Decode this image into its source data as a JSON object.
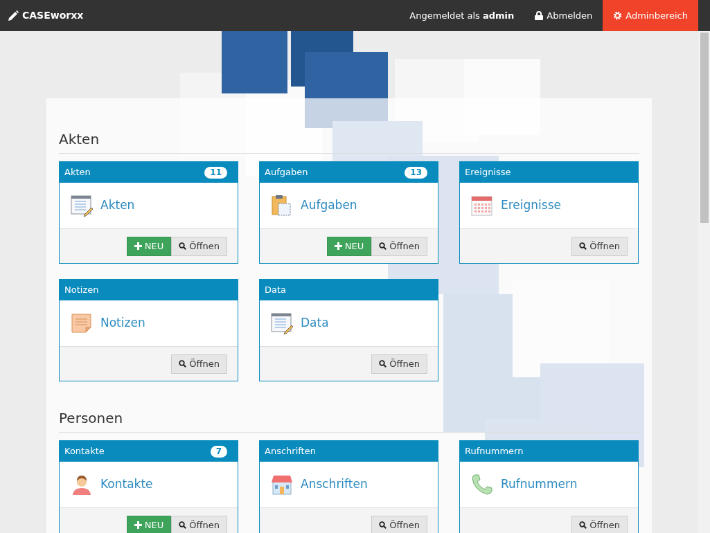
{
  "navbar": {
    "brand": "CASEworxx",
    "user_prefix": "Angemeldet als",
    "user": "admin",
    "logout": "Abmelden",
    "admin": "Adminbereich"
  },
  "sections": [
    {
      "title": "Akten",
      "cards": [
        {
          "title": "Akten",
          "badge": "11",
          "link": "Akten",
          "buttons": [
            {
              "kind": "new",
              "label": "NEU"
            },
            {
              "kind": "open",
              "label": "Öffnen"
            }
          ]
        },
        {
          "title": "Aufgaben",
          "badge": "13",
          "link": "Aufgaben",
          "buttons": [
            {
              "kind": "new",
              "label": "NEU"
            },
            {
              "kind": "open",
              "label": "Öffnen"
            }
          ]
        },
        {
          "title": "Ereignisse",
          "link": "Ereignisse",
          "buttons": [
            {
              "kind": "open",
              "label": "Öffnen"
            }
          ]
        },
        {
          "title": "Notizen",
          "link": "Notizen",
          "buttons": [
            {
              "kind": "open",
              "label": "Öffnen"
            }
          ]
        },
        {
          "title": "Data",
          "link": "Data",
          "buttons": [
            {
              "kind": "open",
              "label": "Öffnen"
            }
          ]
        }
      ]
    },
    {
      "title": "Personen",
      "cards": [
        {
          "title": "Kontakte",
          "badge": "7",
          "link": "Kontakte",
          "buttons": [
            {
              "kind": "new",
              "label": "NEU"
            },
            {
              "kind": "open",
              "label": "Öffnen"
            }
          ]
        },
        {
          "title": "Anschriften",
          "link": "Anschriften",
          "buttons": [
            {
              "kind": "open",
              "label": "Öffnen"
            }
          ]
        },
        {
          "title": "Rufnummern",
          "link": "Rufnummern",
          "buttons": [
            {
              "kind": "open",
              "label": "Öffnen"
            }
          ]
        }
      ]
    }
  ]
}
